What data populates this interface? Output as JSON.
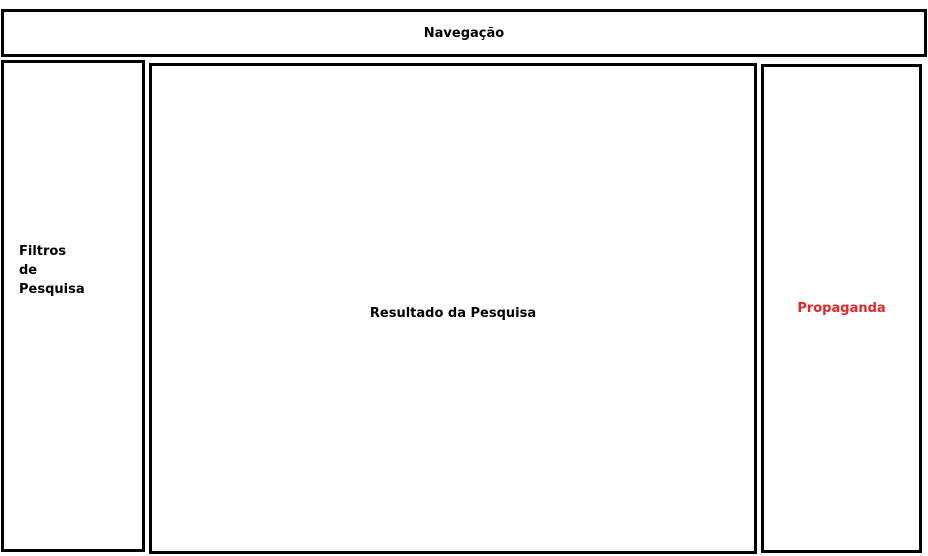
{
  "navigation": {
    "label": "Navegação"
  },
  "filters": {
    "lines": [
      "Filtros",
      "de",
      "Pesquisa"
    ]
  },
  "results": {
    "label": "Resultado da Pesquisa"
  },
  "ads": {
    "label": "Propaganda",
    "color": "#e32626"
  }
}
